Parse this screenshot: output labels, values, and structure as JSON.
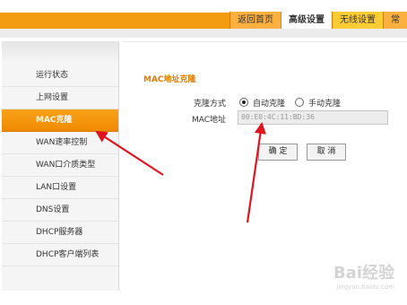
{
  "header": {
    "tabs": [
      {
        "label": "返回首页"
      },
      {
        "label": "高级设置"
      },
      {
        "label": "无线设置"
      },
      {
        "label": "常"
      }
    ]
  },
  "sidebar": {
    "items": [
      {
        "label": "运行状态"
      },
      {
        "label": "上网设置"
      },
      {
        "label": "MAC克隆"
      },
      {
        "label": "WAN速率控制"
      },
      {
        "label": "WAN口介质类型"
      },
      {
        "label": "LAN口设置"
      },
      {
        "label": "DNS设置"
      },
      {
        "label": "DHCP服务器"
      },
      {
        "label": "DHCP客户端列表"
      }
    ]
  },
  "main": {
    "title": "MAC地址克隆",
    "clone_method_label": "克隆方式",
    "option_auto": "自动克隆",
    "option_manual": "手动克隆",
    "mac_label": "MAC地址",
    "mac_value": "00:E0:4C:11:BD:36",
    "confirm_label": "确 定",
    "cancel_label": "取 消"
  },
  "watermark": {
    "text": "Bai经验",
    "sub": "jingyan.baidu.com"
  },
  "colors": {
    "accent": "#f39c12",
    "arrow": "#e0141e"
  }
}
